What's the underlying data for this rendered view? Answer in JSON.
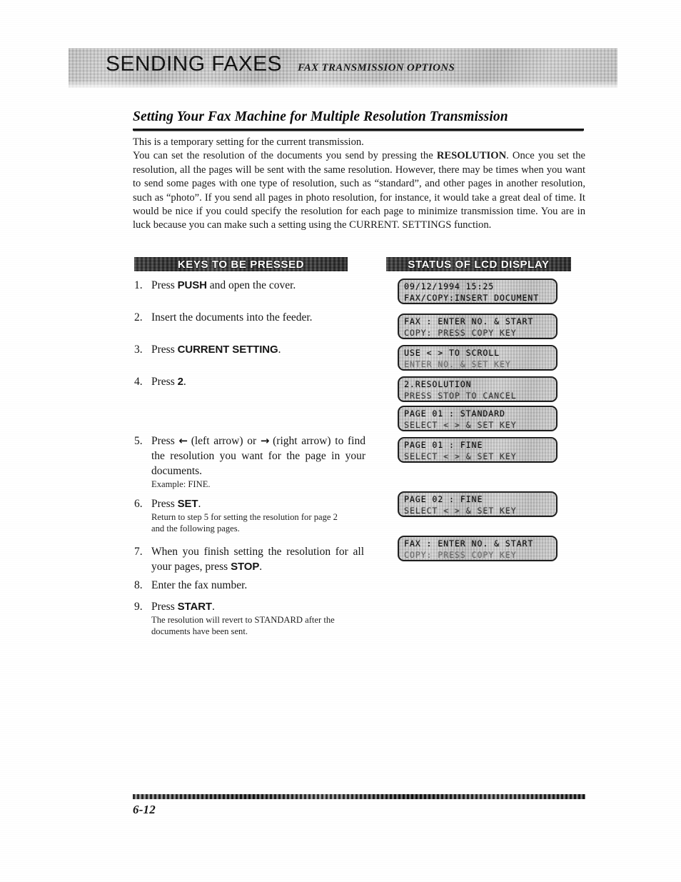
{
  "header": {
    "chapter_title": "SENDING FAXES",
    "chapter_subtitle": "FAX TRANSMISSION OPTIONS"
  },
  "section": {
    "title": "Setting Your Fax Machine for Multiple Resolution Transmission",
    "intro_lead": "This is a temporary setting for the current transmission.",
    "intro_body_1": "You can set the resolution of the documents you send by pressing the ",
    "intro_bold_1": "RESOLUTION",
    "intro_body_2": ". Once you set the resolution, all the pages will be sent with the same resolution. However, there may be times when you want to send some pages with one type of resolution, such as “standard”, and other pages in another resolution, such as “photo”. If you send all pages in photo resolution, for instance, it would take a great deal of time. It would be nice if you could specify the resolution for each page to minimize transmission time. You are in luck because you can make such a setting using the CURRENT. SETTINGS function."
  },
  "columns": {
    "keys_bar_label": "KEYS TO BE PRESSED",
    "status_bar_label": "STATUS OF LCD DISPLAY"
  },
  "steps": [
    {
      "num": "1.",
      "pre": "Press ",
      "key": "PUSH",
      "post": " and open the cover.",
      "note": ""
    },
    {
      "num": "2.",
      "pre": "Insert the documents into the feeder.",
      "key": "",
      "post": "",
      "note": ""
    },
    {
      "num": "3.",
      "pre": "Press ",
      "key": "CURRENT SETTING",
      "post": ".",
      "note": ""
    },
    {
      "num": "4.",
      "pre": "Press ",
      "key": "2",
      "post": ".",
      "note": ""
    },
    {
      "num": "5.",
      "pre": "Press ",
      "arrow_left": "←",
      "mid_1": " (left arrow) or ",
      "arrow_right": "→",
      "mid_2": " (right arrow) to find the resolution you want for the page in your documents.",
      "note": "Example: FINE."
    },
    {
      "num": "6.",
      "pre": "Press ",
      "key": "SET",
      "post": ".",
      "note": "Return to step 5 for setting the resolution for page 2 and the following pages."
    },
    {
      "num": "7.",
      "pre": "When you finish setting the resolution for all your pages, press ",
      "key": "STOP",
      "post": ".",
      "note": ""
    },
    {
      "num": "8.",
      "pre": "Enter the fax number.",
      "key": "",
      "post": "",
      "note": ""
    },
    {
      "num": "9.",
      "pre": "Press ",
      "key": "START",
      "post": ".",
      "note": "The resolution will revert to STANDARD after the documents have been sent."
    }
  ],
  "lcd_panels": [
    {
      "line1": "09/12/1994 15:25",
      "line2": "FAX/COPY:INSERT DOCUMENT"
    },
    {
      "line1": "FAX : ENTER NO. & START",
      "line2": "COPY: PRESS COPY KEY"
    },
    {
      "line1": "USE < > TO SCROLL",
      "line2": "ENTER NO. & SET KEY"
    },
    {
      "line1": "2.RESOLUTION",
      "line2": "PRESS STOP TO CANCEL"
    },
    {
      "line1": "PAGE 01 : STANDARD",
      "line2": "SELECT < > & SET KEY"
    },
    {
      "line1": "PAGE 01 : FINE",
      "line2": "SELECT < > & SET KEY"
    },
    {
      "line1": "PAGE 02 : FINE",
      "line2": "SELECT < > & SET KEY"
    },
    {
      "line1": "FAX : ENTER NO. & START",
      "line2": "COPY: PRESS COPY KEY"
    }
  ],
  "footer": {
    "page_number": "6-12"
  }
}
